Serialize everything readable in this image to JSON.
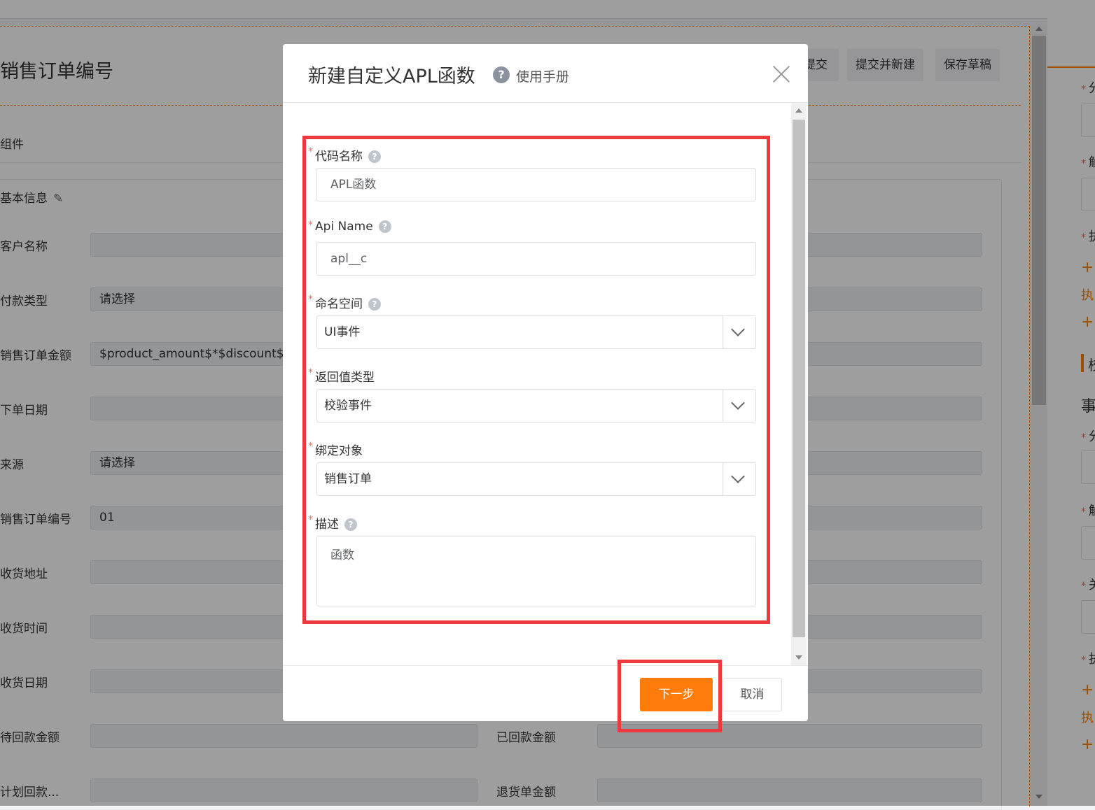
{
  "page": {
    "title": "销售订单编号",
    "header_buttons": [
      "提交",
      "提交并新建",
      "保存草稿"
    ],
    "components_label": "组件",
    "section_title": "基本信息",
    "rows": [
      {
        "label": "客户名称",
        "value": ""
      },
      {
        "label": "付款类型",
        "value": "请选择"
      },
      {
        "label": "销售订单金额",
        "value": "$product_amount$*$discount$"
      },
      {
        "label": "下单日期",
        "value": ""
      },
      {
        "label": "来源",
        "value": "请选择"
      },
      {
        "label": "销售订单编号",
        "value": "01"
      },
      {
        "label": "收货地址",
        "value": ""
      },
      {
        "label": "收货时间",
        "value": ""
      },
      {
        "label": "收货日期",
        "value": ""
      },
      {
        "label": "待回款金额",
        "value": "",
        "right_label": "已回款金额"
      },
      {
        "label": "计划回款...",
        "value": "",
        "right_label": "退货单金额"
      }
    ]
  },
  "right_panel": {
    "items": [
      "分",
      "触",
      "执",
      "执",
      "校",
      "事",
      "分",
      "触",
      "关",
      "执",
      "执"
    ]
  },
  "dialog": {
    "title": "新建自定义APL函数",
    "help_link": "使用手册",
    "fields": {
      "code_name": {
        "label": "代码名称",
        "value": "APL函数"
      },
      "api_name": {
        "label": "Api Name",
        "value": "apl__c"
      },
      "namespace": {
        "label": "命名空间",
        "value": "UI事件"
      },
      "return_type": {
        "label": "返回值类型",
        "value": "校验事件"
      },
      "bind_object": {
        "label": "绑定对象",
        "value": "销售订单"
      },
      "description": {
        "label": "描述",
        "value": "函数"
      }
    },
    "next_button": "下一步",
    "cancel_button": "取消"
  },
  "colors": {
    "accent": "#ff7c0a",
    "highlight": "#ee3a3f",
    "required": "#f56c6c"
  }
}
